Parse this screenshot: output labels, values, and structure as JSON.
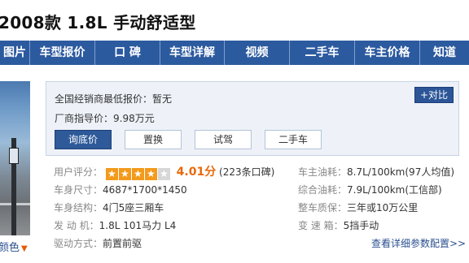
{
  "page_title": "2008款 1.8L 手动舒适型",
  "nav": [
    {
      "label": "图片"
    },
    {
      "label": "车型报价"
    },
    {
      "label": "口 碑"
    },
    {
      "label": "车型详解"
    },
    {
      "label": "视频"
    },
    {
      "label": "二手车"
    },
    {
      "label": "车主价格"
    },
    {
      "label": "知道"
    }
  ],
  "photo": {
    "color_link": "颜色",
    "caret": "▼"
  },
  "price_box": {
    "dealer_low_label": "全国经销商最低报价：",
    "dealer_low_value": "暂无",
    "msrp_label": "厂商指导价：",
    "msrp_value": "9.98万元",
    "compare_button": "+对比",
    "buttons": [
      {
        "label": "询底价"
      },
      {
        "label": "置换"
      },
      {
        "label": "试驾"
      },
      {
        "label": "二手车"
      }
    ]
  },
  "specs": {
    "rating_label": "用户评分：",
    "rating_stars": 4,
    "rating_max": 5,
    "rating_value": "4.01分",
    "rating_count": "(223条口碑)",
    "fuel_label": "车主油耗：",
    "fuel_value": "8.7L/100km(97人均值)",
    "size_label": "车身尺寸：",
    "size_value": "4687*1700*1450",
    "combined_fuel_label": "综合油耗：",
    "combined_fuel_value": "7.9L/100km(工信部)",
    "body_label": "车身结构：",
    "body_value": "4门5座三厢车",
    "warranty_label": "整车质保：",
    "warranty_value": "三年或10万公里",
    "engine_label": "发 动 机：",
    "engine_value": "1.8L 101马力 L4",
    "gearbox_label": "变 速 箱：",
    "gearbox_value": "5挡手动",
    "drive_label": "驱动方式：",
    "drive_value": "前置前驱",
    "more_link": "查看详细参数配置>>"
  },
  "colors": {
    "nav_bg": "#2c5a9f",
    "primary_button": "#2e5a99",
    "star_on": "#f39a1c",
    "score": "#e8690a",
    "link": "#2a4f8f"
  }
}
